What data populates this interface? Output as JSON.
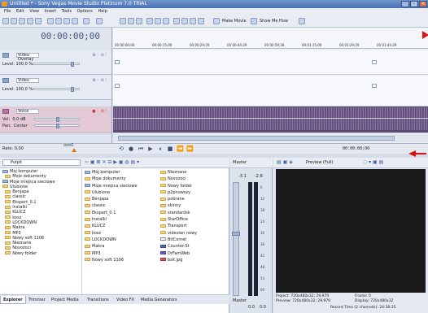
{
  "window": {
    "title": "Untitled * - Sony Vegas Movie Studio Platinum 7.0 TRIAL"
  },
  "menu": [
    "File",
    "Edit",
    "View",
    "Insert",
    "Tools",
    "Options",
    "Help"
  ],
  "toolbar": {
    "make_movie": "Make Movie",
    "show_me_how": "Show Me How"
  },
  "timecode": "00:00:00;00",
  "tracks": [
    {
      "name": "Video Overlay",
      "level_label": "Level:",
      "level_value": "100,0 %"
    },
    {
      "name": "Video",
      "level_label": "Level:",
      "level_value": "100,0 %"
    },
    {
      "name": "Voice",
      "vol_label": "Vol:",
      "vol_value": "0,0 dB",
      "pan_label": "Pan:",
      "pan_value": "Center"
    }
  ],
  "ruler_ticks": [
    "00:00:00;00",
    "00:00:15;00",
    "00:00:29;29",
    "00:00:44;29",
    "00:00:59;28",
    "00:01:15;00",
    "00:01:29;29",
    "00:01:44;29"
  ],
  "rate": {
    "label": "Rate: 0,00",
    "speed": "ooo0"
  },
  "transport_time": "00:00:00;00",
  "explorer": {
    "location": "Pulpit",
    "tree": [
      "Mój komputer",
      "Moje dokumenty",
      "Moje miejsca sieciowe",
      "Ulubione",
      "Benjapa",
      "classic",
      "Ekspert_0.1",
      "Instalki",
      "KLUCZ",
      "kosz",
      "LOCKDOWN",
      "Makra",
      "MP3",
      "Nowy soft 1106",
      "Nieznane",
      "Novozoci",
      "Nowy folder"
    ],
    "files_col1": [
      "Mój komputer",
      "Moje dokumenty",
      "Moje miejsca sieciowe",
      "Ulubione",
      "Benjapa",
      "classic",
      "Ekspert_0.1",
      "Instalki",
      "KLUCZ",
      "kosz",
      "LOCKDOWN",
      "Makra",
      "MP3",
      "Nowy soft 1106"
    ],
    "files_col2": [
      "Nieznane",
      "Novozoci",
      "Nowy folder",
      "p2pnowszy",
      "pobrane",
      "skinny",
      "standardsk",
      "StarOffice",
      "Transport",
      "videolan nowy",
      "BitComet",
      "Counter-St",
      "DrFamWeb",
      "bsit.jpg"
    ],
    "tabs": [
      "Explorer",
      "Trimmer",
      "Project Media",
      "Transitions",
      "Video FX",
      "Media Generators"
    ]
  },
  "mixer": {
    "header": "Master",
    "left_level": "-3.1",
    "right_level": "-2.8",
    "scale": [
      "6",
      "12",
      "18",
      "24",
      "30",
      "36",
      "42",
      "48",
      "54",
      "60"
    ],
    "bus_label": "Master",
    "bottom_values": [
      "0.0",
      "0.0"
    ]
  },
  "preview": {
    "label": "Preview (Full)",
    "project": "Project:  720x480x32; 29,970",
    "preview_res": "Preview: 720x480x32; 29,970",
    "frame": "Frame:    0",
    "display": "Display:  720x480x32",
    "record_time": "Record Time (2 channels): 24:38:35"
  },
  "accent_color": "#d11111"
}
